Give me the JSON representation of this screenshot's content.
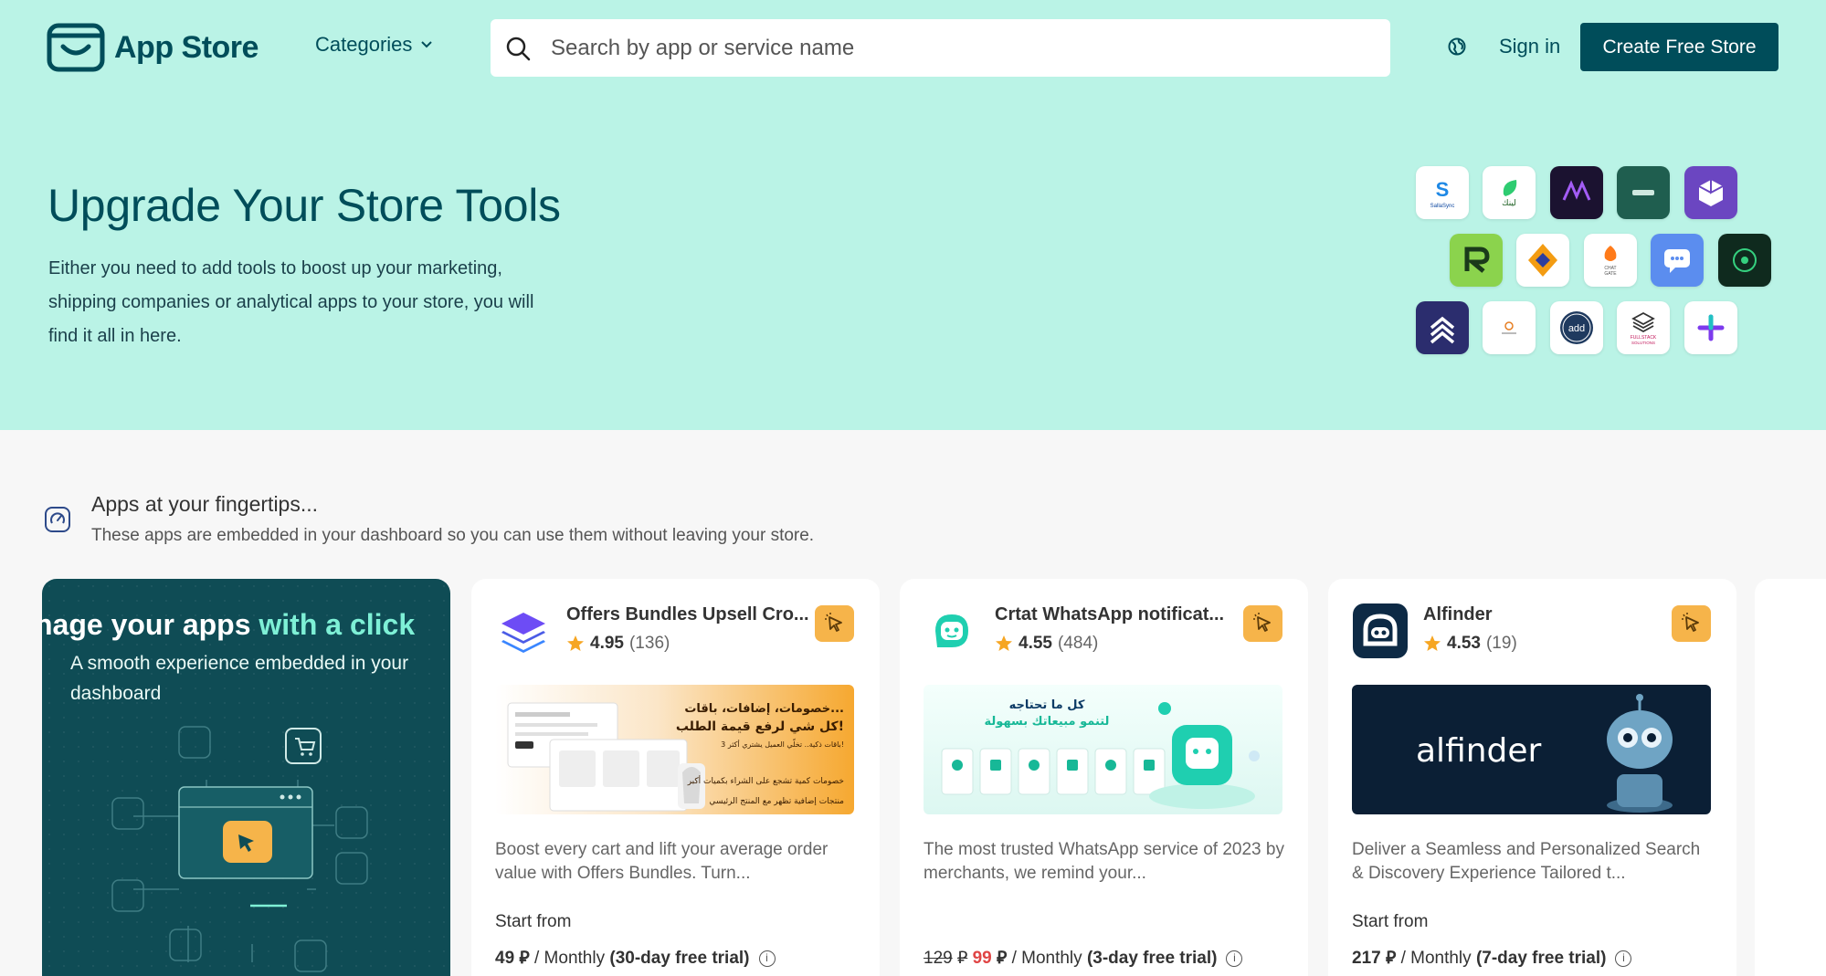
{
  "header": {
    "logo_text": "App Store",
    "categories_label": "Categories",
    "search_placeholder": "Search by app or service name",
    "signin_label": "Sign in",
    "create_label": "Create Free Store"
  },
  "hero": {
    "title": "Upgrade Your Store Tools",
    "description": "Either you need to add tools to boost up your marketing, shipping companies or analytical apps to your store, you will find it all in here."
  },
  "section": {
    "title": "Apps at your fingertips...",
    "subtitle": "These apps are embedded in your dashboard so you can use them without leaving your store."
  },
  "promo": {
    "title_main": "nage your apps ",
    "title_highlight": "with a click",
    "subtitle": "A smooth experience embedded in your dashboard"
  },
  "apps": [
    {
      "name": "Offers Bundles Upsell Cro...",
      "rating": "4.95",
      "reviews": "(136)",
      "description": "Boost every cart and lift your average order value with Offers Bundles. Turn...",
      "start_label": "Start from",
      "price": "49",
      "currency": "⃁",
      "period": "/ Monthly",
      "trial": "(30-day free trial)",
      "banner_lines": [
        "خصومات، إضافات، باقات...",
        "كل شي لرفع قيمة الطلب!",
        "3 باقات ذكية.. تخلّي العميل يشتري أكثر!",
        "خصومات كمية تشجع على الشراء بكميات أكبر",
        "منتجات إضافية تظهر مع المنتج الرئيسي"
      ]
    },
    {
      "name": "Crtat WhatsApp notificat...",
      "rating": "4.55",
      "reviews": "(484)",
      "description": "The most trusted WhatsApp service of 2023 by merchants, we remind your...",
      "start_label": "",
      "old_price": "129",
      "price": "99",
      "currency": "⃁",
      "period": "/ Monthly",
      "trial": "(3-day free trial)",
      "banner_lines": [
        "كل ما تحتاجه",
        "لتنمو مبيعاتك بسهولة"
      ]
    },
    {
      "name": "Alfinder",
      "rating": "4.53",
      "reviews": "(19)",
      "description": "Deliver a Seamless and Personalized Search & Discovery Experience Tailored t...",
      "start_label": "Start from",
      "price": "217",
      "currency": "⃁",
      "period": "/ Monthly",
      "trial": "(7-day free trial)",
      "banner_lines": [
        "alfinder"
      ]
    }
  ],
  "hero_icons": [
    {
      "name": "sallasync-app-icon",
      "label": "SallaSync"
    },
    {
      "name": "leaf-app-icon",
      "label": "لينك"
    },
    {
      "name": "purple-dark-app-icon",
      "label": ""
    },
    {
      "name": "teal-dark-app-icon",
      "label": ""
    },
    {
      "name": "cube-app-icon",
      "label": ""
    },
    {
      "name": "green-r-app-icon",
      "label": ""
    },
    {
      "name": "star-diamond-app-icon",
      "label": ""
    },
    {
      "name": "chat-gate-app-icon",
      "label": "CHAT GATE"
    },
    {
      "name": "chat-bubble-app-icon",
      "label": ""
    },
    {
      "name": "circle-dark-app-icon",
      "label": ""
    },
    {
      "name": "chevrons-app-icon",
      "label": ""
    },
    {
      "name": "small-logo-app-icon",
      "label": ""
    },
    {
      "name": "add-app-icon",
      "label": "add"
    },
    {
      "name": "fullstack-app-icon",
      "label": "FULLSTACK SOLUTIONS"
    },
    {
      "name": "plus-app-icon",
      "label": ""
    }
  ],
  "colors": {
    "hero_bg": "#baf3e6",
    "brand_dark": "#004d5a",
    "promo_bg": "#0f4c55",
    "accent_highlight": "#7ef0d6",
    "badge_orange": "#f6b44a",
    "price_red": "#e04545",
    "star": "#f6a623"
  }
}
